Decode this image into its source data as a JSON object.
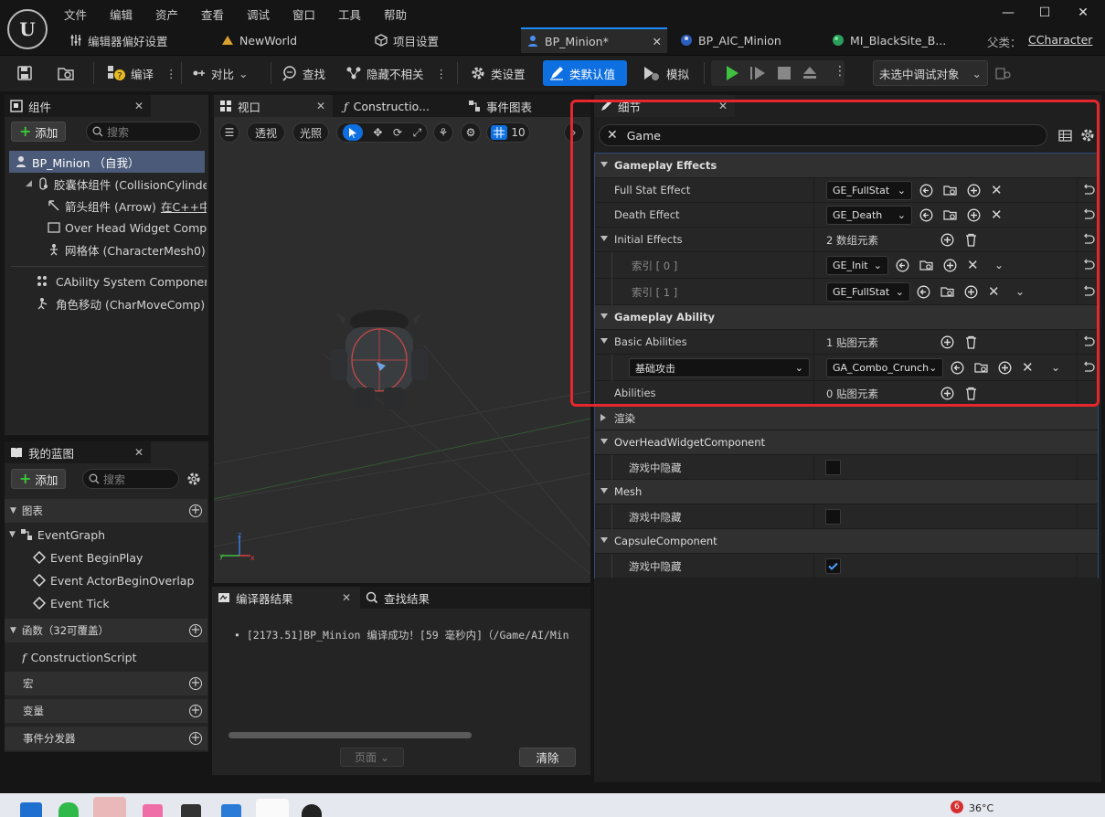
{
  "menu": [
    "文件",
    "编辑",
    "资产",
    "查看",
    "调试",
    "窗口",
    "工具",
    "帮助"
  ],
  "doc_tabs": [
    {
      "label": "编辑器偏好设置",
      "active": false
    },
    {
      "label": "NewWorld",
      "active": false
    },
    {
      "label": "项目设置",
      "active": false
    },
    {
      "label": "BP_Minion*",
      "active": true
    },
    {
      "label": "BP_AIC_Minion",
      "active": false
    },
    {
      "label": "MI_BlackSite_B...",
      "active": false
    }
  ],
  "parent_class_label": "父类：",
  "parent_class_value": "CCharacter",
  "toolbar": {
    "compile": "编译",
    "diff": "对比",
    "find": "查找",
    "hide_unrelated": "隐藏不相关",
    "class_settings": "类设置",
    "class_defaults": "类默认值",
    "simulate": "模拟",
    "debug_target": "未选中调试对象"
  },
  "components": {
    "tab": "组件",
    "add": "添加",
    "search_placeholder": "搜索",
    "items": [
      "BP_Minion （自我）",
      "胶囊体组件 (CollisionCylinde",
      "箭头组件 (Arrow)",
      "在C++中",
      "Over Head Widget Compor",
      "网格体 (CharacterMesh0)",
      "CAbility System Component",
      "角色移动 (CharMoveComp)"
    ]
  },
  "blueprint": {
    "tab": "我的蓝图",
    "add": "添加",
    "search_placeholder": "搜索",
    "graphs": "图表",
    "event_graph": "EventGraph",
    "events": [
      "Event BeginPlay",
      "Event ActorBeginOverlap",
      "Event Tick"
    ],
    "functions": "函数（32可覆盖）",
    "construction": "ConstructionScript",
    "macros": "宏",
    "variables": "变量",
    "dispatchers": "事件分发器"
  },
  "editor_tabs": {
    "viewport": "视口",
    "construction": "Constructio...",
    "event_graph": "事件图表",
    "details": "细节"
  },
  "viewport": {
    "perspective": "透视",
    "lit": "光照",
    "grid_size": "10"
  },
  "compiler": {
    "tab": "编译器结果",
    "find_tab": "查找结果",
    "message": "[2173.51]BP_Minion 编译成功！[59 毫秒内]（/Game/AI/Min",
    "page": "页面",
    "clear": "清除"
  },
  "details": {
    "search_value": "Game",
    "rows": [
      {
        "label": "Gameplay Effects",
        "kind": "cat"
      },
      {
        "label": "Full Stat Effect",
        "value": "GE_FullStat"
      },
      {
        "label": "Death Effect",
        "value": "GE_Death"
      },
      {
        "label": "Initial Effects",
        "value": "2 数组元素"
      },
      {
        "label": "索引 [ 0 ]",
        "value": "GE_Init"
      },
      {
        "label": "索引 [ 1 ]",
        "value": "GE_FullStat"
      },
      {
        "label": "Gameplay Ability",
        "kind": "cat"
      },
      {
        "label": "Basic Abilities",
        "value": "1 贴图元素"
      },
      {
        "label": "基础攻击",
        "value": "GA_Combo_Crunch"
      },
      {
        "label": "Abilities",
        "value": "0 贴图元素"
      },
      {
        "label": "渲染",
        "kind": "cat"
      },
      {
        "label": "OverHeadWidgetComponent",
        "kind": "cat"
      },
      {
        "label": "游戏中隐藏",
        "checked": false
      },
      {
        "label": "Mesh",
        "kind": "cat"
      },
      {
        "label": "游戏中隐藏",
        "checked": false
      },
      {
        "label": "CapsuleComponent",
        "kind": "cat"
      },
      {
        "label": "游戏中隐藏",
        "checked": true
      }
    ]
  },
  "taskbar": {
    "weather": "36°C",
    "badge": "6"
  },
  "colors": {
    "accent": "#0e70e0",
    "highlight": "#e8262d"
  }
}
